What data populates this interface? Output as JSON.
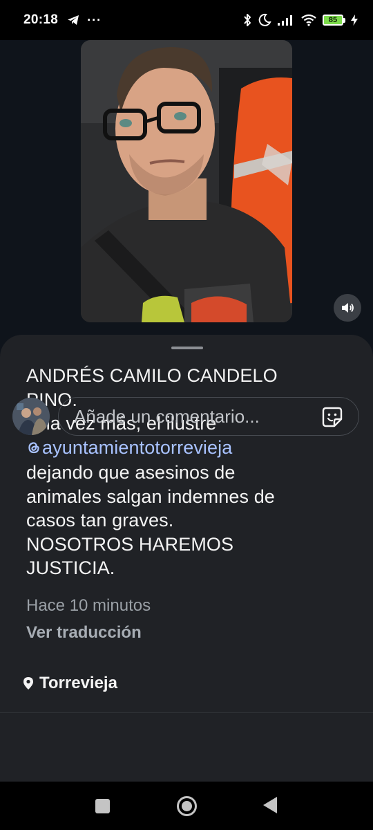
{
  "status_bar": {
    "time": "20:18",
    "notification_dots": "···",
    "battery_level": "85",
    "icons": [
      "telegram-icon",
      "bluetooth-icon",
      "do-not-disturb-moon-icon",
      "signal-icon",
      "wifi-icon",
      "battery-icon",
      "charging-bolt-icon"
    ]
  },
  "video": {
    "sound_icon": "speaker-volume-icon"
  },
  "post": {
    "caption_lines": [
      "ANDRÉS CAMILO CANDELO",
      "PINO.",
      "Una vez más, el ilustre"
    ],
    "mention": "ayuntamientotorrevieja",
    "caption_lines_after": [
      "dejando que asesinos de",
      "animales salgan indemnes de",
      "casos tan graves.",
      "NOSOTROS HAREMOS",
      "JUSTICIA."
    ],
    "timestamp": "Hace 10 minutos",
    "translate_label": "Ver traducción",
    "location": "Torrevieja"
  },
  "comment": {
    "placeholder": "Añade un comentario..."
  },
  "colors": {
    "background": "#0f141b",
    "sheet": "#202226",
    "mention": "#a8c2ff",
    "battery": "#7ddc4b"
  }
}
